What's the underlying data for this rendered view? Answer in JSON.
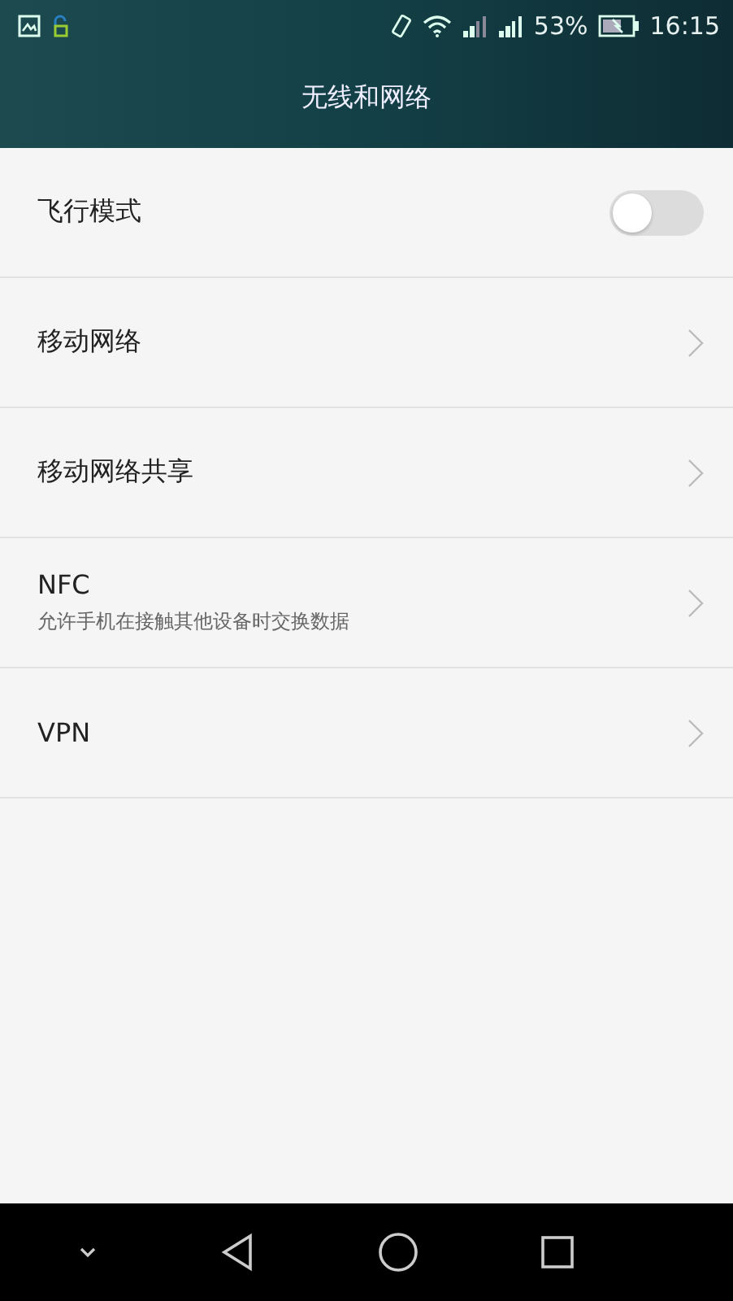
{
  "status_bar": {
    "battery": "53%",
    "time": "16:15"
  },
  "header": {
    "title": "无线和网络"
  },
  "items": [
    {
      "kind": "toggle",
      "label": "飞行模式",
      "on": false
    },
    {
      "kind": "link",
      "label": "移动网络"
    },
    {
      "kind": "link",
      "label": "移动网络共享"
    },
    {
      "kind": "link",
      "label": "NFC",
      "subtitle": "允许手机在接触其他设备时交换数据"
    },
    {
      "kind": "link",
      "label": "VPN"
    }
  ]
}
